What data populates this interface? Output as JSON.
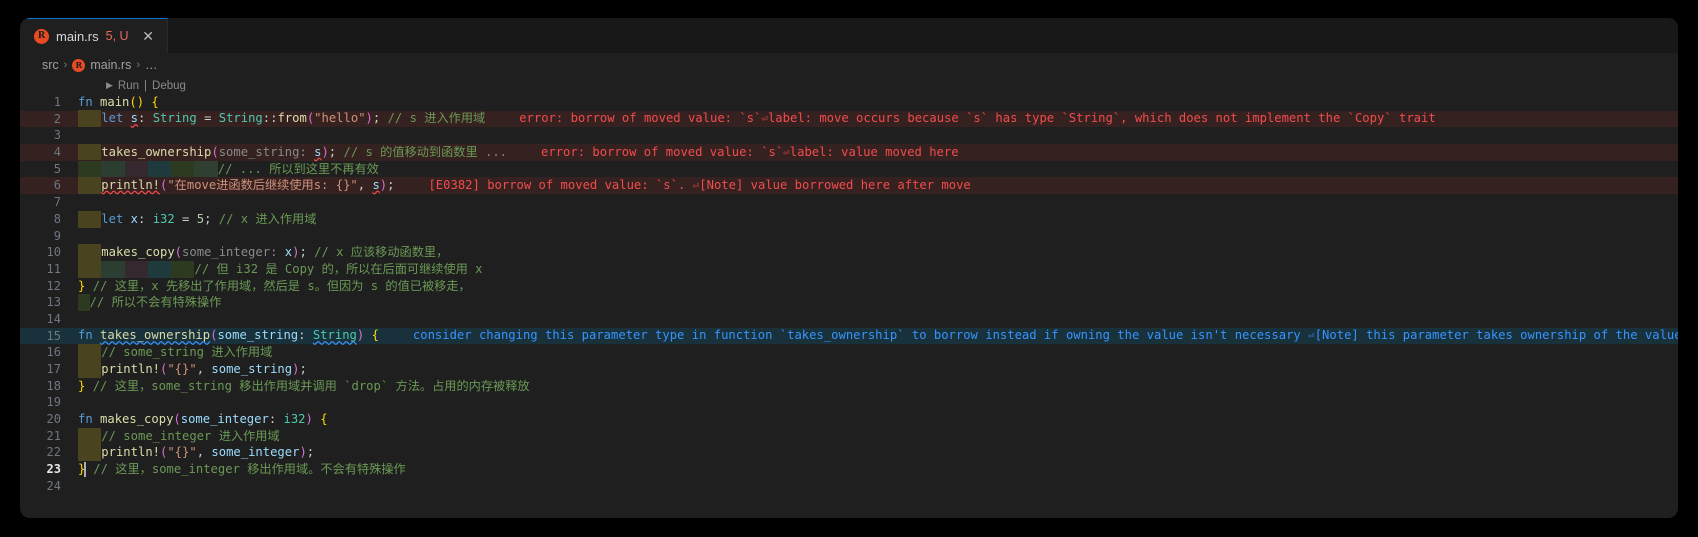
{
  "window": {
    "background": "#000000",
    "editor_background": "#1f1f1f"
  },
  "tab": {
    "icon": "rust-file-icon",
    "filename": "main.rs",
    "problem_count": "5, U",
    "close_label": "✕"
  },
  "breadcrumb": {
    "root": "src",
    "separator": "›",
    "file": "main.rs",
    "tail": "…"
  },
  "codelens": {
    "play_glyph": "▶",
    "run": "Run",
    "divider": "|",
    "debug": "Debug"
  },
  "colors": {
    "error": "#f14c4c",
    "info": "#3794ff",
    "comment": "#6a9955",
    "keyword": "#569cd6",
    "type": "#4ec9b0",
    "string": "#ce9178",
    "function": "#dcdcaa",
    "accent": "#0078d4",
    "rust_icon": "#e84a22"
  },
  "editor": {
    "language": "rust",
    "current_line": 23,
    "lines": [
      {
        "n": 1,
        "text": "fn main() {"
      },
      {
        "n": 2,
        "text": "    let s: String = String::from(\"hello\"); // s 进入作用域"
      },
      {
        "n": 3,
        "text": ""
      },
      {
        "n": 4,
        "text": "    takes_ownership(s); // s 的值移动到函数里 ..."
      },
      {
        "n": 5,
        "text": "                    // ... 所以到这里不再有效"
      },
      {
        "n": 6,
        "text": "    println!(\"在move进函数后继续使用s: {}\", s);"
      },
      {
        "n": 7,
        "text": ""
      },
      {
        "n": 8,
        "text": "    let x: i32 = 5; // x 进入作用域"
      },
      {
        "n": 9,
        "text": ""
      },
      {
        "n": 10,
        "text": "    makes_copy(x); // x 应该移动函数里，"
      },
      {
        "n": 11,
        "text": "                   // 但 i32 是 Copy 的，所以在后面可继续使用 x"
      },
      {
        "n": 12,
        "text": "} // 这里，x 先移出了作用域，然后是 s。但因为 s 的值已被移走，"
      },
      {
        "n": 13,
        "text": "  // 所以不会有特殊操作"
      },
      {
        "n": 14,
        "text": ""
      },
      {
        "n": 15,
        "text": "fn takes_ownership(some_string: String) {"
      },
      {
        "n": 16,
        "text": "    // some_string 进入作用域"
      },
      {
        "n": 17,
        "text": "    println!(\"{}\", some_string);"
      },
      {
        "n": 18,
        "text": "} // 这里，some_string 移出作用域并调用 `drop` 方法。占用的内存被释放"
      },
      {
        "n": 19,
        "text": ""
      },
      {
        "n": 20,
        "text": "fn makes_copy(some_integer: i32) {"
      },
      {
        "n": 21,
        "text": "    // some_integer 进入作用域"
      },
      {
        "n": 22,
        "text": "    println!(\"{}\", some_integer);"
      },
      {
        "n": 23,
        "text": "} // 这里，some_integer 移出作用域。不会有特殊操作"
      },
      {
        "n": 24,
        "text": ""
      }
    ],
    "inlay_hints": {
      "line4": "some_string:",
      "line10": "some_integer:"
    },
    "diagnostics": {
      "line2": "error: borrow of moved value: `s`⏎label: move occurs because `s` has type `String`, which does not implement the `Copy` trait",
      "line2_head": "error: borrow of moved value: `s`",
      "line2_tail": "label: move occurs because `s` has type `String`, which does not implement the `Copy` trait",
      "line4_head": "error: borrow of moved value: `s`",
      "line4_tail": "label: value moved here",
      "line6_code": "[E0382]",
      "line6_head": "borrow of moved value: `s`.",
      "line6_tail": "[Note] value borrowed here after move",
      "line15_head": "consider changing this parameter type in function `takes_ownership` to borrow instead if owning the value isn't necessary",
      "line15_tail": "[Note] this parameter takes ownership of the value",
      "cr_glyph": "⏎"
    }
  }
}
